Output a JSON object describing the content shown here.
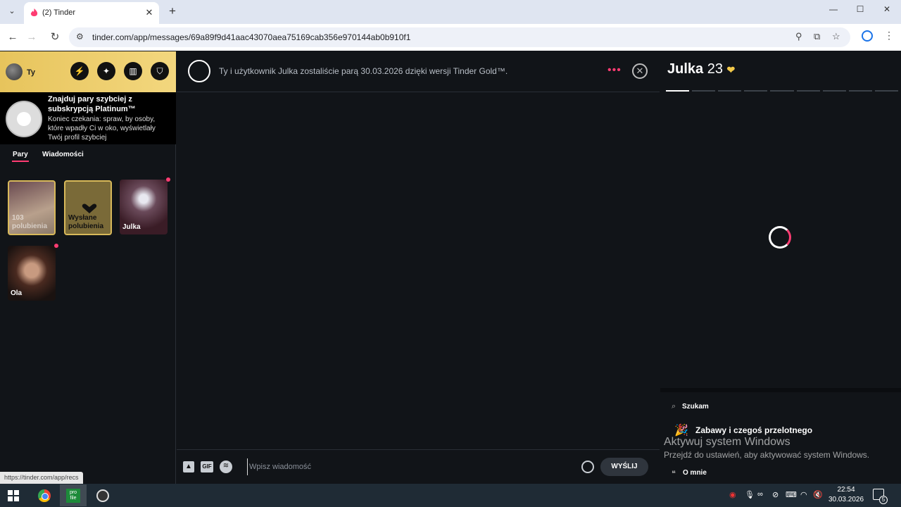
{
  "browser": {
    "tab_title": "(2) Tinder",
    "url": "tinder.com/app/messages/69a89f9d41aac43070aea75169cab356e970144ab0b910f1",
    "status_url": "https://tinder.com/app/recs"
  },
  "sidebar": {
    "user_name": "Ty",
    "promo": {
      "title": "Znajduj pary szybciej z subskrypcją Platinum™",
      "text": "Koniec czekania: spraw, by osoby, które wpadły Ci w oko, wyświetlały Twój profil szybciej"
    },
    "tabs": [
      {
        "label": "Pary",
        "active": true
      },
      {
        "label": "Wiadomości",
        "active": false
      }
    ],
    "matches": [
      {
        "label": "103 polubienia",
        "kind": "likes"
      },
      {
        "label": "Wysłane polubienia",
        "kind": "sent"
      },
      {
        "label": "Julka",
        "kind": "person",
        "unread": true
      },
      {
        "label": "Ola",
        "kind": "person",
        "unread": true
      }
    ]
  },
  "chat": {
    "match_text": "Ty i użytkownik Julka zostaliście parą 30.03.2026 dzięki wersji Tinder Gold™.",
    "input_placeholder": "Wpisz wiadomość",
    "send_label": "WYŚLIJ",
    "gif_label": "GIF"
  },
  "profile": {
    "name": "Julka",
    "age": "23",
    "photo_count": 9,
    "looking_for_label": "Szukam",
    "looking_for_value": "Zabawy i czegoś przelotnego",
    "about_label": "O mnie"
  },
  "watermark": {
    "title": "Aktywuj system Windows",
    "subtitle": "Przejdź do ustawień, aby aktywować system Windows."
  },
  "taskbar": {
    "time": "22:54",
    "date": "30.03.2026",
    "notification_count": "5",
    "profile_app_label": "pro file"
  },
  "colors": {
    "accent": "#fe3c72",
    "gold": "#e7c45c",
    "background": "#111418"
  }
}
